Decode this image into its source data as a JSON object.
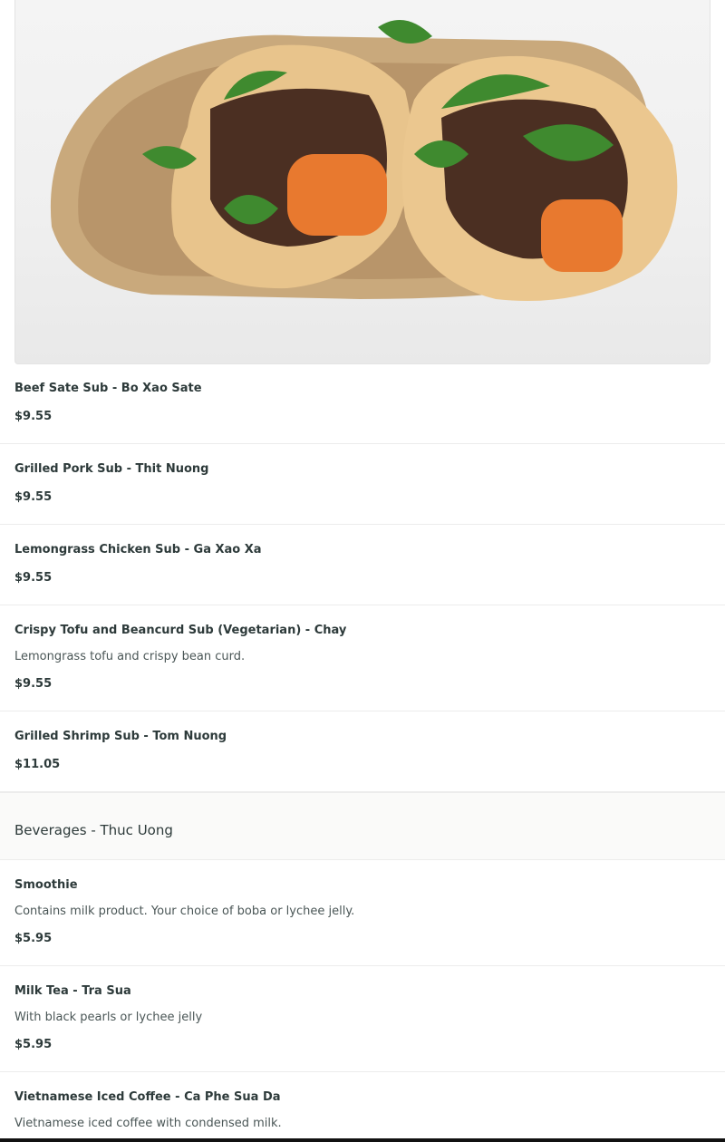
{
  "hero": {
    "image": "banh-mi-sandwich-photo"
  },
  "items": [
    {
      "name": "Beef Sate Sub - Bo Xao Sate",
      "description": "",
      "price": "$9.55"
    },
    {
      "name": "Grilled Pork Sub - Thit Nuong",
      "description": "",
      "price": "$9.55"
    },
    {
      "name": "Lemongrass Chicken Sub - Ga Xao Xa",
      "description": "",
      "price": "$9.55"
    },
    {
      "name": "Crispy Tofu and Beancurd Sub (Vegetarian) - Chay",
      "description": "Lemongrass tofu and crispy bean curd.",
      "price": "$9.55"
    },
    {
      "name": "Grilled Shrimp Sub - Tom Nuong",
      "description": "",
      "price": "$11.05"
    }
  ],
  "section": {
    "title": "Beverages - Thuc Uong"
  },
  "beverages": [
    {
      "name": "Smoothie",
      "description": "Contains milk product. Your choice of boba or lychee jelly.",
      "price": "$5.95"
    },
    {
      "name": "Milk Tea - Tra Sua",
      "description": "With black pearls or lychee jelly",
      "price": "$5.95"
    },
    {
      "name": "Vietnamese Iced Coffee - Ca Phe Sua Da",
      "description": "Vietnamese iced coffee with condensed milk.",
      "price": ""
    }
  ]
}
